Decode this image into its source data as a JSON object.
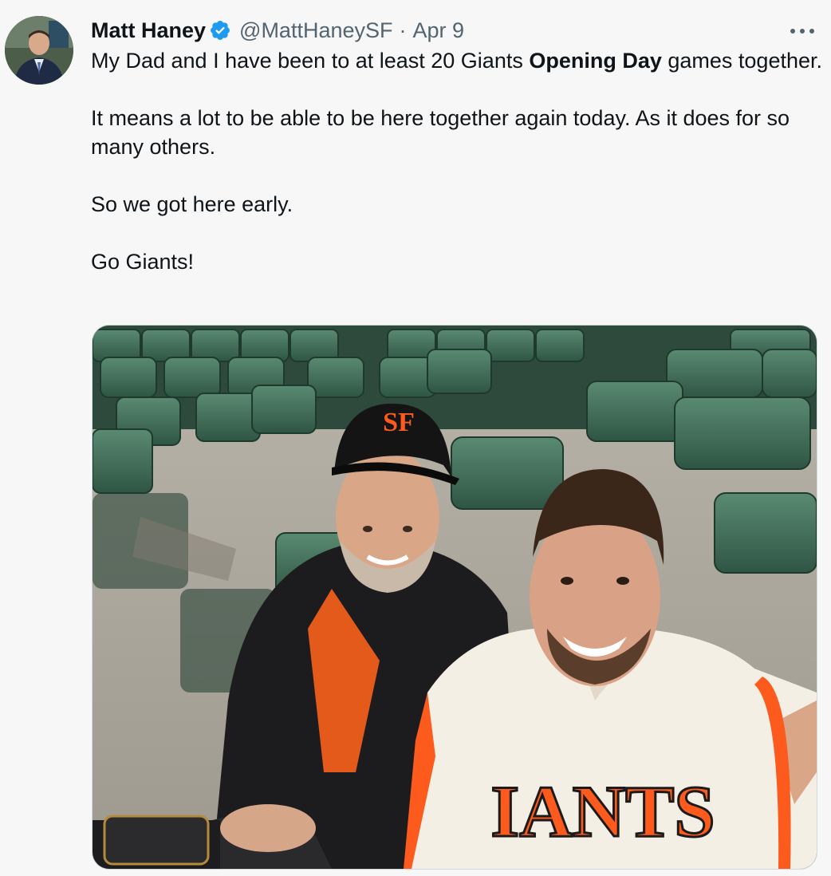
{
  "tweet": {
    "display_name": "Matt Haney",
    "handle": "@MattHaneySF",
    "separator": "·",
    "date": "Apr 9",
    "verified": true,
    "more_icon": "more-horizontal-icon",
    "text": {
      "line1_a": "My Dad and I have been to at least 20 Giants ",
      "line1_bold": "Opening Day",
      "line1_b": " games together.",
      "para2": "It means a lot to be able to be here together again today.  As it does for so many others.",
      "para3": "So we got here early.",
      "para4": "Go Giants!"
    },
    "photo": {
      "cap_logo": "SF",
      "jersey_text": "IANTS"
    },
    "colors": {
      "verified_blue": "#1d9bf0",
      "giants_orange": "#fd5a1e",
      "seat_green": "#3f6b56"
    }
  }
}
